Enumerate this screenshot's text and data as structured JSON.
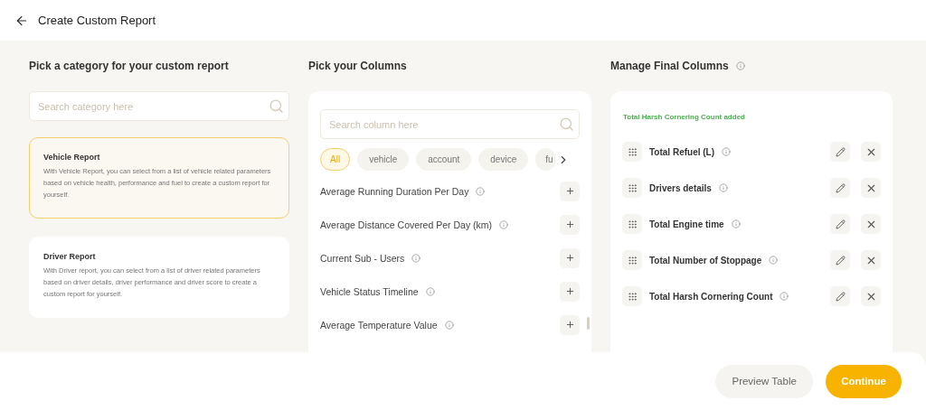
{
  "header": {
    "title": "Create Custom Report"
  },
  "categories": {
    "heading": "Pick a category for your custom report",
    "search": {
      "placeholder": "Search category here"
    },
    "items": [
      {
        "title": "Vehicle Report",
        "description": "With Vehicle Report, you can select from a list of vehicle related parameters based on vehicle health, performance and fuel to create a custom report for yourself.",
        "selected": true
      },
      {
        "title": "Driver Report",
        "description": "With Driver report, you can select from a list of driver related parameters based on driver details, driver performance and driver score to create a custom report for yourself.",
        "selected": false
      }
    ]
  },
  "columns": {
    "heading": "Pick your Columns",
    "search": {
      "placeholder": "Search column here"
    },
    "filters": [
      {
        "label": "All",
        "selected": true
      },
      {
        "label": "vehicle",
        "selected": false
      },
      {
        "label": "account",
        "selected": false
      },
      {
        "label": "device",
        "selected": false
      },
      {
        "label": "fu",
        "selected": false
      }
    ],
    "items": [
      "Average Running Duration Per Day",
      "Average Distance Covered Per Day (km)",
      "Current Sub - Users",
      "Vehicle Status Timeline",
      "Average Temperature Value"
    ]
  },
  "final": {
    "heading": "Manage Final Columns",
    "notice": "Total Harsh Cornering Count added",
    "items": [
      "Total Refuel (L)",
      "Drivers details",
      "Total Engine time",
      "Total Number of Stoppage",
      "Total Harsh Cornering Count"
    ]
  },
  "footer": {
    "buttons": [
      {
        "label": "Preview Table",
        "kind": "secondary"
      },
      {
        "label": "Continue",
        "kind": "primary"
      }
    ]
  }
}
